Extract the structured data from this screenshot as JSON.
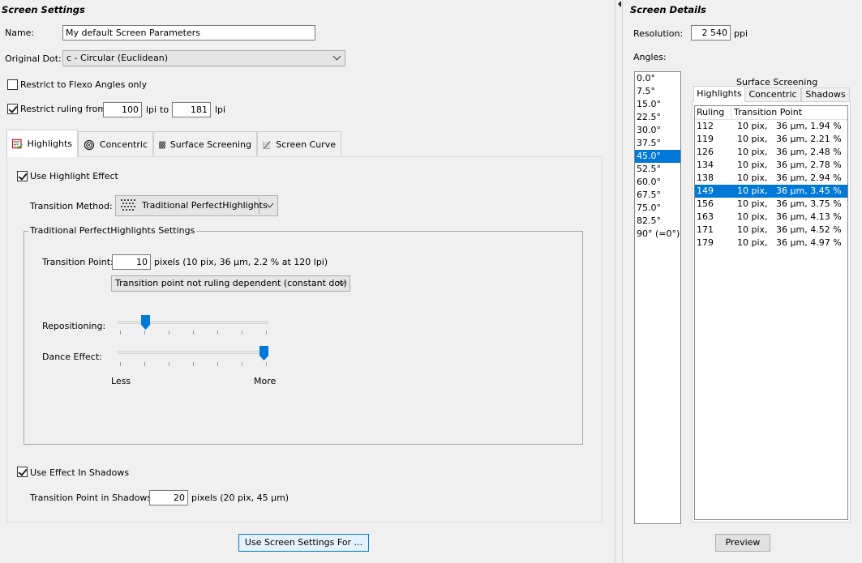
{
  "left": {
    "title": "Screen Settings",
    "name_label": "Name:",
    "name_value": "My default Screen Parameters",
    "dot_label": "Original Dot:",
    "dot_value": "c - Circular (Euclidean)",
    "restrict_flexo_label": "Restrict to Flexo Angles only",
    "restrict_ruling_label": "Restrict ruling from",
    "ruling_from": "100",
    "lpi1": "lpi",
    "to_label": "to",
    "ruling_to": "181",
    "lpi2": "lpi",
    "tabs": [
      {
        "label": "Highlights",
        "icon": "highlights-icon"
      },
      {
        "label": "Concentric",
        "icon": "concentric-icon"
      },
      {
        "label": "Surface Screening",
        "icon": "surface-screening-icon"
      },
      {
        "label": "Screen Curve",
        "icon": "screen-curve-icon"
      }
    ],
    "use_highlight_label": "Use Highlight Effect",
    "transition_method_label": "Transition Method:",
    "transition_method_value": "Traditional PerfectHighlights",
    "group_title": "Traditional PerfectHighlights Settings",
    "transition_point_label": "Transition Point:",
    "transition_point_value": "10",
    "transition_point_info": "pixels  (10 pix, 36 µm, 2.2 % at 120 lpi)",
    "transition_dependency_value": "Transition point not ruling dependent (constant dot)",
    "repositioning_label": "Repositioning:",
    "repositioning_level": 0.167,
    "dance_label": "Dance Effect:",
    "dance_level": 1.0,
    "less_label": "Less",
    "more_label": "More",
    "use_shadows_label": "Use Effect In Shadows",
    "shadows_tp_label": "Transition Point in Shadows:",
    "shadows_tp_value": "20",
    "shadows_tp_info": "pixels  (20 pix, 45 µm)",
    "use_settings_button": "Use Screen Settings For ..."
  },
  "right": {
    "title": "Screen Details",
    "resolution_label": "Resolution:",
    "resolution_value": "2 540",
    "resolution_unit": "ppi",
    "angles_label": "Angles:",
    "angles": [
      "0.0°",
      "7.5°",
      "15.0°",
      "22.5°",
      "30.0°",
      "37.5°",
      "45.0°",
      "52.5°",
      "60.0°",
      "67.5°",
      "75.0°",
      "82.5°",
      "90° (=0°)"
    ],
    "selected_angle_index": 6,
    "surface_screening_label": "Surface Screening",
    "tabs": [
      "Highlights",
      "Concentric",
      "Shadows"
    ],
    "table_headers": [
      "Ruling",
      "Transition Point"
    ],
    "rows": [
      [
        "112",
        "10 pix,   36 µm, 1.94 %"
      ],
      [
        "119",
        "10 pix,   36 µm, 2.21 %"
      ],
      [
        "126",
        "10 pix,   36 µm, 2.48 %"
      ],
      [
        "134",
        "10 pix,   36 µm, 2.78 %"
      ],
      [
        "138",
        "10 pix,   36 µm, 2.94 %"
      ],
      [
        "149",
        "10 pix,   36 µm, 3.45 %"
      ],
      [
        "156",
        "10 pix,   36 µm, 3.75 %"
      ],
      [
        "163",
        "10 pix,   36 µm, 4.13 %"
      ],
      [
        "171",
        "10 pix,   36 µm, 4.52 %"
      ],
      [
        "179",
        "10 pix,   36 µm, 4.97 %"
      ]
    ],
    "selected_row_index": 5,
    "preview_button": "Preview"
  },
  "colors": {
    "selection": "#0078d7",
    "background": "#f0f0f0"
  }
}
